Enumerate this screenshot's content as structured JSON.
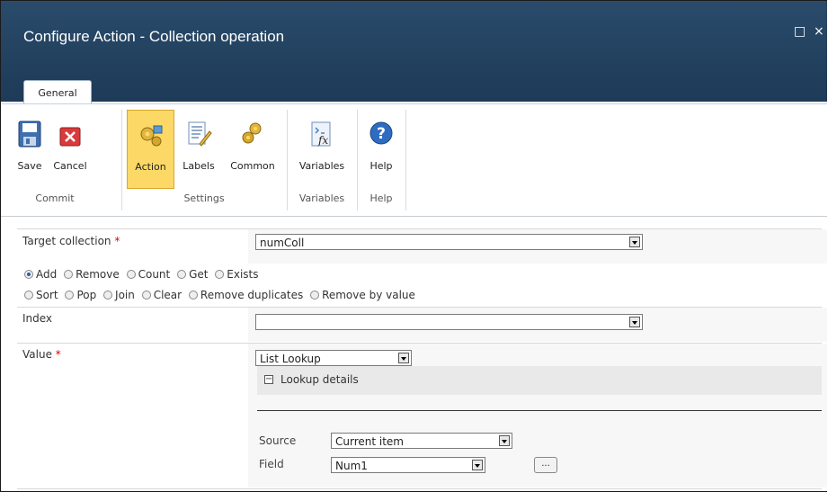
{
  "window": {
    "title": "Configure Action - Collection operation",
    "restore_glyph": "□",
    "close_glyph": "×"
  },
  "tabs": [
    {
      "label": "General"
    }
  ],
  "ribbon": {
    "buttons": {
      "save": "Save",
      "cancel": "Cancel",
      "action": "Action",
      "labels": "Labels",
      "common": "Common",
      "variables": "Variables",
      "help": "Help"
    },
    "groups": {
      "commit": "Commit",
      "settings": "Settings",
      "variables": "Variables",
      "help": "Help"
    }
  },
  "form": {
    "target_collection": {
      "label": "Target collection",
      "required_mark": "*",
      "value": "numColl"
    },
    "operations_row1": [
      "Add",
      "Remove",
      "Count",
      "Get",
      "Exists"
    ],
    "operations_row2": [
      "Sort",
      "Pop",
      "Join",
      "Clear",
      "Remove duplicates",
      "Remove by value"
    ],
    "selected_operation": "Add",
    "index": {
      "label": "Index",
      "value": ""
    },
    "value": {
      "label": "Value",
      "required_mark": "*",
      "selected": "List Lookup"
    },
    "lookup": {
      "header": "Lookup details",
      "collapse_glyph": "−",
      "source_label": "Source",
      "source_value": "Current item",
      "field_label": "Field",
      "field_value": "Num1",
      "more_button": "..."
    }
  }
}
